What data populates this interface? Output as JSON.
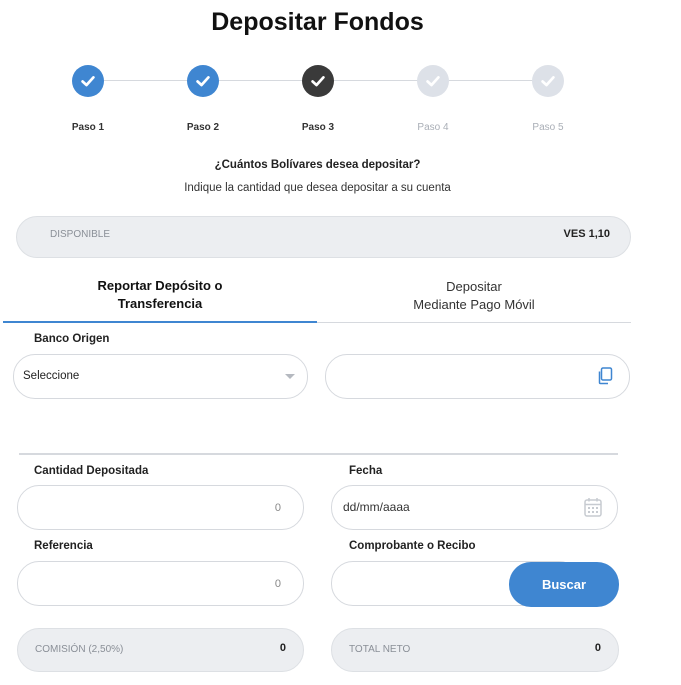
{
  "page": {
    "title": "Depositar Fondos"
  },
  "stepper": {
    "steps": [
      {
        "label": "Paso 1",
        "state": "done"
      },
      {
        "label": "Paso 2",
        "state": "done"
      },
      {
        "label": "Paso 3",
        "state": "current"
      },
      {
        "label": "Paso 4",
        "state": "pending"
      },
      {
        "label": "Paso 5",
        "state": "pending"
      }
    ],
    "icon": "check-icon"
  },
  "prompt": {
    "question": "¿Cuántos Bolívares desea depositar?",
    "subtitle": "Indique la cantidad que desea depositar a su cuenta"
  },
  "available": {
    "label": "DISPONIBLE",
    "value": "VES 1,10"
  },
  "tabs": [
    {
      "line1": "Reportar Depósito o",
      "line2": "Transferencia",
      "active": true
    },
    {
      "line1": "Depositar",
      "line2": "Mediante Pago Móvil",
      "active": false
    }
  ],
  "bank": {
    "label": "Banco Origen",
    "selected": "Seleccione",
    "account_value": "",
    "copy_icon": "copy-icon"
  },
  "form": {
    "amount_label": "Cantidad Depositada",
    "amount_value": "0",
    "date_label": "Fecha",
    "date_placeholder": "dd/mm/aaaa",
    "reference_label": "Referencia",
    "reference_value": "0",
    "receipt_label": "Comprobante o Recibo",
    "search_button": "Buscar",
    "commission_label": "COMISIÓN (2,50%)",
    "commission_value": "0",
    "net_label": "TOTAL NETO",
    "net_value": "0"
  },
  "colors": {
    "accent": "#3f86d1",
    "current_step": "#3a3a3a",
    "pending_step": "#dde1e8",
    "readonly_bg": "#eceef1"
  }
}
